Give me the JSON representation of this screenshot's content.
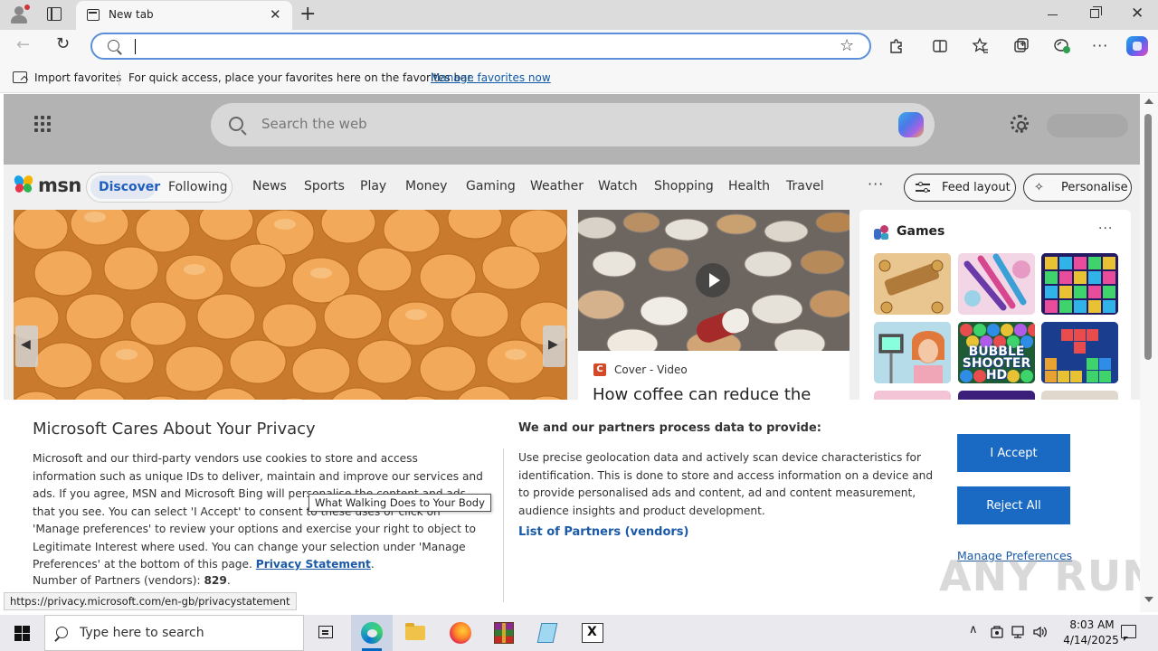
{
  "browser": {
    "tab_title": "New tab",
    "tab_close": "✕",
    "new_tab": "+",
    "window_close": "✕",
    "address_placeholder": "",
    "back_glyph": "←",
    "refresh_glyph": "↻",
    "star_glyph": "☆"
  },
  "favorites_bar": {
    "import_label": "Import favorites",
    "message": "For quick access, place your favorites here on the favorites bar.",
    "manage_link": "Manage favorites now"
  },
  "msn": {
    "search_placeholder": "Search the web",
    "logo_text": "msn",
    "tabs": {
      "discover": "Discover",
      "following": "Following"
    },
    "nav_items": [
      "News",
      "Sports",
      "Play",
      "Money",
      "Gaming",
      "Weather",
      "Watch",
      "Shopping",
      "Health",
      "Travel"
    ],
    "more": "···",
    "feed_layout": "Feed layout",
    "personalise": "Personalise",
    "colors": {
      "accent": "#1f5fbf",
      "consent_button": "#1a6ac4"
    }
  },
  "cards": {
    "mid": {
      "source_icon_letter": "C",
      "source": "Cover - Video",
      "headline": "How coffee can reduce the"
    },
    "games": {
      "title": "Games",
      "more": "···",
      "bubble_text": "BUBBLE SHOOTER HD"
    }
  },
  "consent": {
    "title": "Microsoft Cares About Your Privacy",
    "body": "Microsoft and our third-party vendors use cookies to store and access information such as unique IDs to deliver, maintain and improve our services and ads. If you agree, MSN and Microsoft Bing will personalise the content and ads that you see. You can select 'I Accept' to consent to these uses or click on 'Manage preferences' to review your options and exercise your right to object to Legitimate Interest where used.  You can change your selection under 'Manage Preferences' at the bottom of this page. ",
    "privacy_link": "Privacy Statement",
    "partners_label": "Number of Partners (vendors): ",
    "partners_count": "829",
    "right_title": "We and our partners process data to provide:",
    "right_body": "Use precise geolocation data and actively scan device characteristics for identification. This is done to store and access information on a device and to provide personalised ads and content, ad and content measurement, audience insights and product development.",
    "list_link": "List of Partners (vendors)",
    "accept": "I Accept",
    "reject": "Reject All",
    "manage": "Manage Preferences",
    "tooltip": "What Walking Does to Your Body",
    "status_url": "https://privacy.microsoft.com/en-gb/privacystatement",
    "watermark": "ANY RUN"
  },
  "taskbar": {
    "search_placeholder": "Type here to search",
    "time": "8:03 AM",
    "date": "4/14/2025",
    "tray_chevron": "∧"
  }
}
